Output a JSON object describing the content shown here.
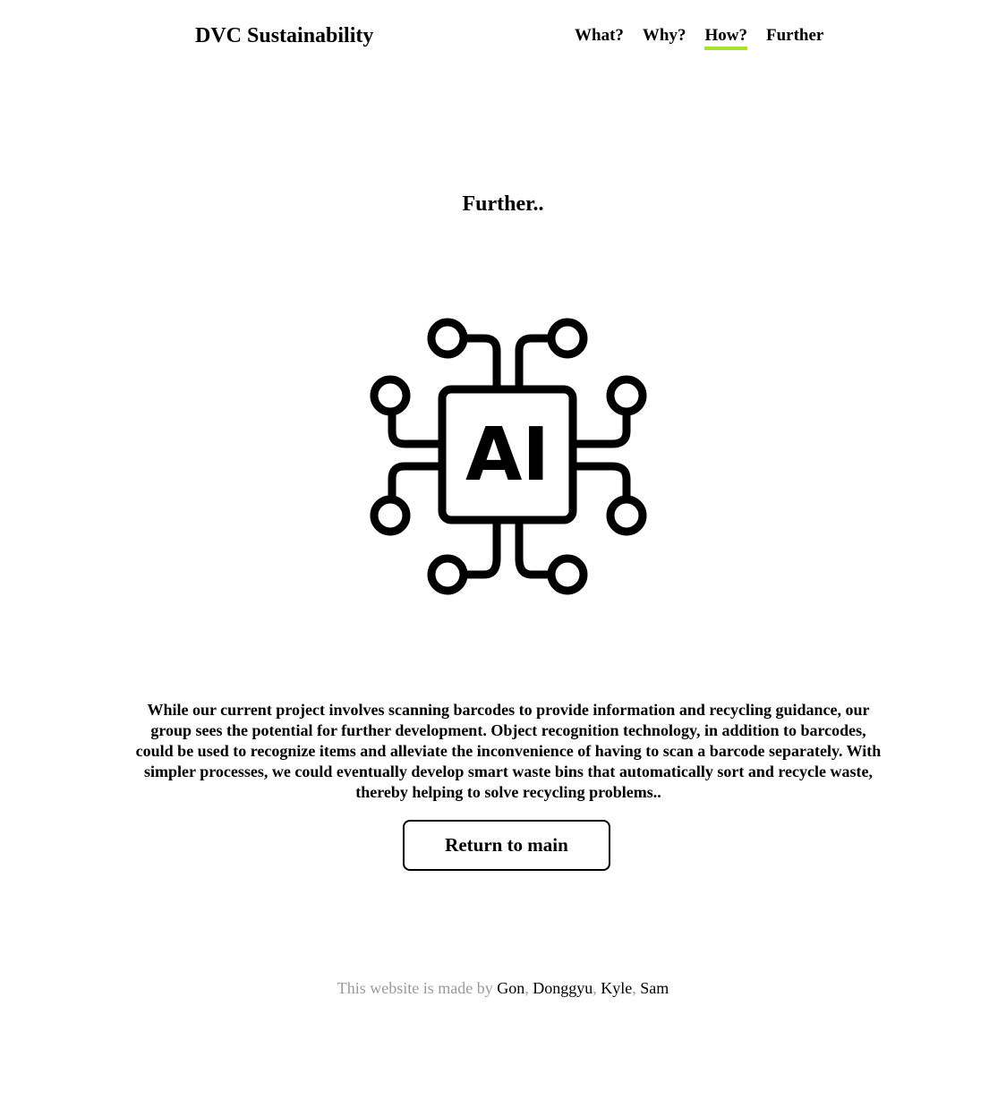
{
  "header": {
    "brand": "DVC Sustainability",
    "nav": [
      {
        "label": "What?",
        "active": false
      },
      {
        "label": "Why?",
        "active": false
      },
      {
        "label": "How?",
        "active": true
      },
      {
        "label": "Further",
        "active": false
      }
    ],
    "active_underline_color": "#a6e22e"
  },
  "main": {
    "title": "Further..",
    "icon": "ai-chip-icon",
    "icon_text": "AI",
    "description": "While our current project involves scanning barcodes to provide information and recycling guidance, our group sees the potential for further development. Object recognition technology, in addition to barcodes, could be used to recognize items and alleviate the inconvenience of having to scan a barcode separately. With simpler processes, we could eventually develop smart waste bins that automatically sort and recycle waste, thereby helping to solve recycling problems..",
    "return_button": "Return to main"
  },
  "footer": {
    "prefix": "This website is made by",
    "authors": [
      "Gon",
      "Donggyu",
      "Kyle",
      "Sam"
    ],
    "separator": ","
  }
}
